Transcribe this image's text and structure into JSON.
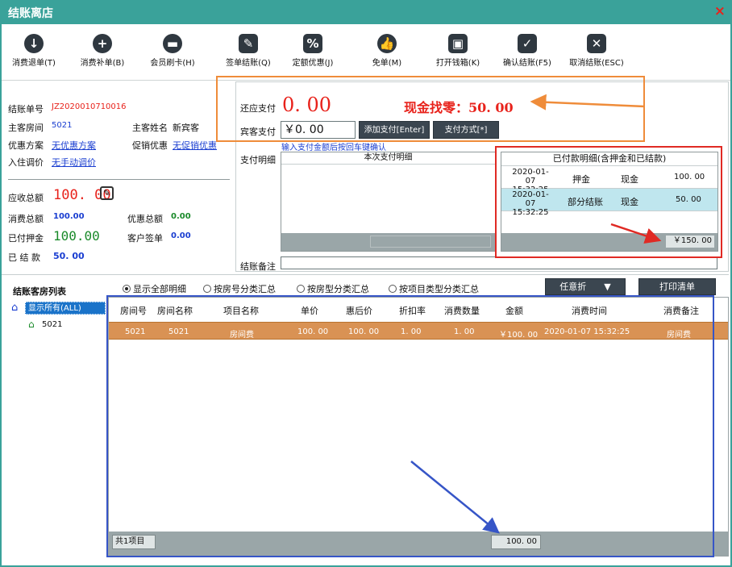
{
  "window": {
    "title": "结账离店",
    "close": "×"
  },
  "toolbar": [
    {
      "label": "消费退单(T)",
      "icon": "download-icon",
      "glyph": "↓"
    },
    {
      "label": "消费补单(B)",
      "icon": "plus-icon",
      "glyph": "+"
    },
    {
      "label": "会员刷卡(H)",
      "icon": "card-icon",
      "glyph": "▬"
    },
    {
      "label": "签单结账(Q)",
      "icon": "sign-icon",
      "glyph": "✎"
    },
    {
      "label": "定额优惠(J)",
      "icon": "percent-icon",
      "glyph": "%"
    },
    {
      "label": "免单(M)",
      "icon": "thumb-icon",
      "glyph": "👍"
    },
    {
      "label": "打开钱箱(K)",
      "icon": "wallet-icon",
      "glyph": "▣"
    },
    {
      "label": "确认结账(F5)",
      "icon": "check-icon",
      "glyph": "✓"
    },
    {
      "label": "取消结账(ESC)",
      "icon": "cancel-icon",
      "glyph": "✕"
    }
  ],
  "info": {
    "bill_no_label": "结账单号",
    "bill_no": "JZ2020010710016",
    "room_label": "主客房间",
    "room": "5021",
    "guest_label": "主客姓名",
    "guest": "新宾客",
    "discount_plan_label": "优惠方案",
    "discount_plan": "无优惠方案",
    "promo_label": "促销优惠",
    "promo": "无促销优惠",
    "price_adj_label": "入住调价",
    "price_adj": "无手动调价",
    "receivable_label": "应收总额",
    "receivable": "100. 00",
    "consume_label": "消费总额",
    "consume": "100.00",
    "discount_total_label": "优惠总额",
    "discount_total": "0.00",
    "deposit_label": "已付押金",
    "deposit": "100.00",
    "sign_label": "客户签单",
    "sign": "0.00",
    "settled_label": "已 结 款",
    "settled": "50. 00"
  },
  "payment": {
    "due_label": "还应支付",
    "due": "0. 00",
    "change_text": "现金找零：50. 00",
    "guest_pay_label": "宾客支付",
    "guest_pay": "￥0. 00",
    "add_btn": "添加支付[Enter]",
    "method_btn": "支付方式[*]",
    "hint": "输入支付金额后按回车键确认",
    "detail_label": "支付明细",
    "detail_header": "本次支付明细",
    "remark_label": "结账备注"
  },
  "paid_detail": {
    "title": "已付款明细(含押金和已结款)",
    "rows": [
      {
        "time": "2020-01-07 15:32:25",
        "type": "押金",
        "method": "现金",
        "amount": "100. 00"
      },
      {
        "time": "2020-01-07 15:32:25",
        "type": "部分结账",
        "method": "现金",
        "amount": "50. 00"
      }
    ],
    "total": "￥150. 00"
  },
  "filters": {
    "radios": [
      "显示全部明细",
      "按房号分类汇总",
      "按房型分类汇总",
      "按项目类型分类汇总"
    ],
    "discount_btn": "任意折",
    "print_btn": "打印清单"
  },
  "tree": {
    "title": "结账客房列表",
    "all": "显示所有(ALL)",
    "room": "5021"
  },
  "grid": {
    "headers": [
      "房间号",
      "房间名称",
      "项目名称",
      "单价",
      "惠后价",
      "折扣率",
      "消费数量",
      "金额",
      "消费时间",
      "消费备注"
    ],
    "row": [
      "5021",
      "5021",
      "房间费",
      "100. 00",
      "100. 00",
      "1. 00",
      "1. 00",
      "￥100. 00",
      "2020-01-07 15:32:25",
      "房间费"
    ],
    "footer_count": "共1项目",
    "footer_total": "100. 00"
  }
}
